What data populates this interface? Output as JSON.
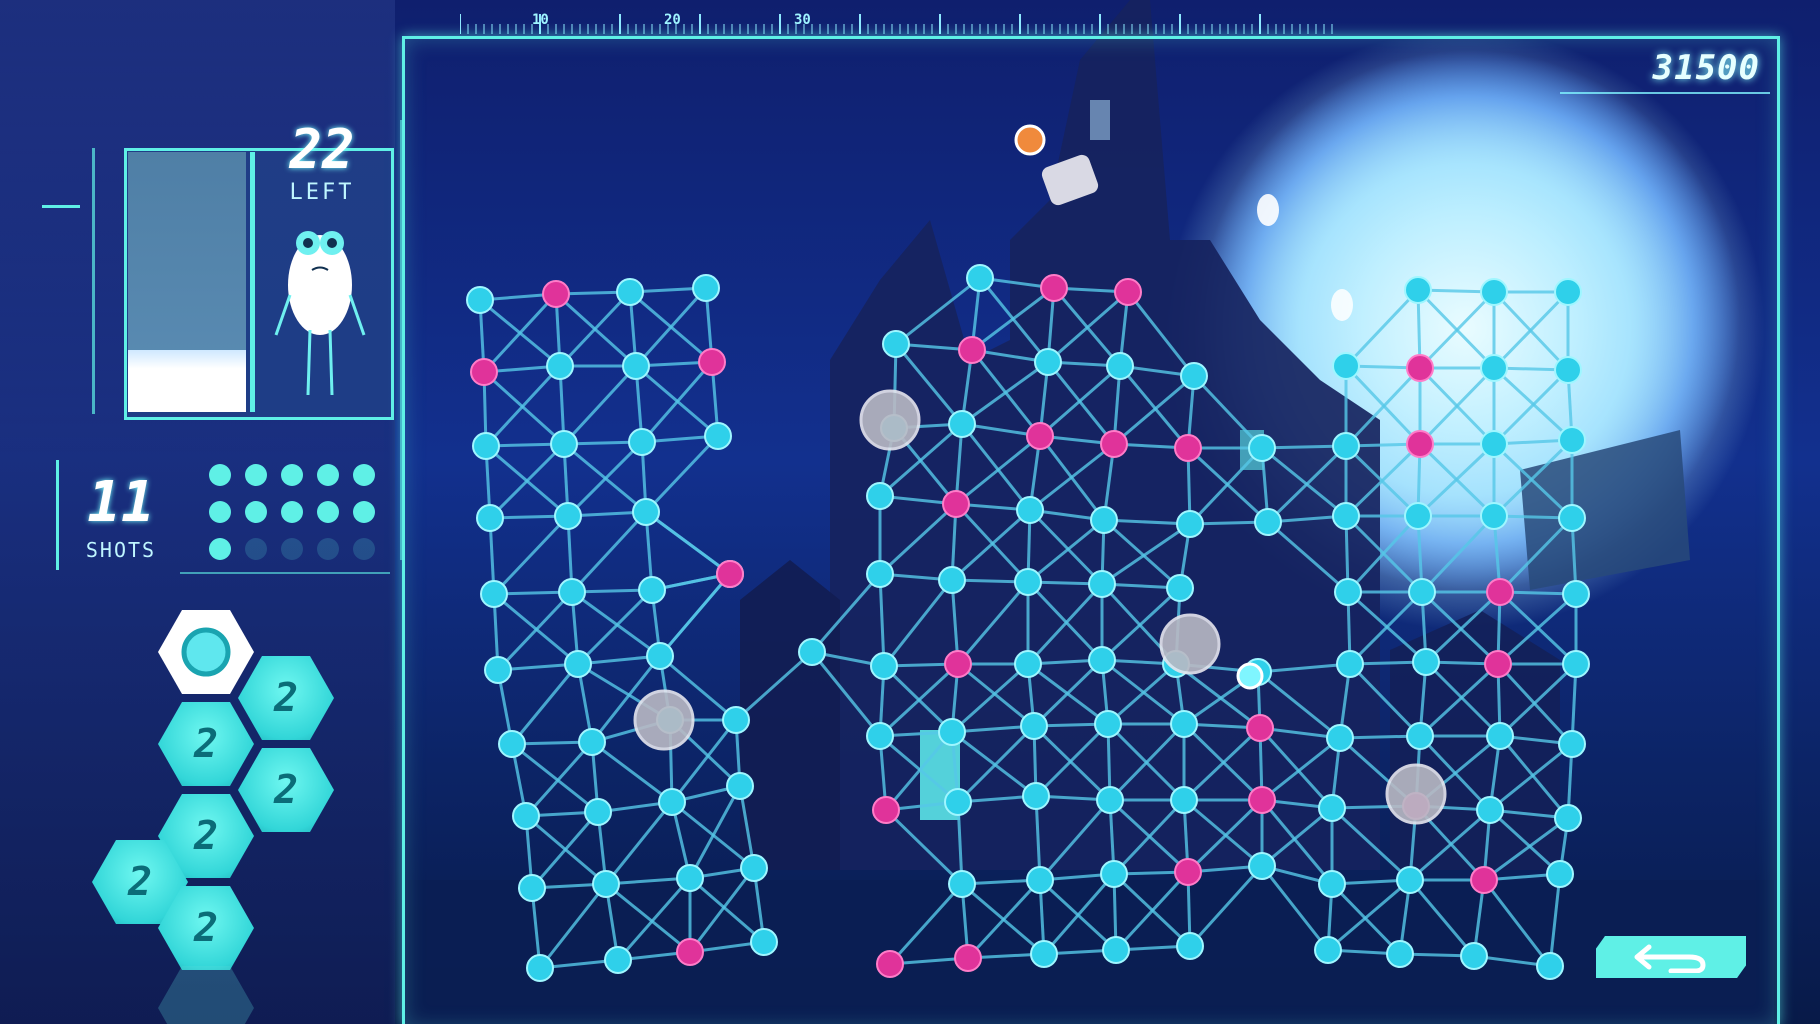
{
  "hud": {
    "score": "31500",
    "ruler_labels": [
      "10",
      "20",
      "30"
    ],
    "ghosts_left_count": "22",
    "ghosts_left_label": "LEFT",
    "ghost_meter_fraction": 0.24,
    "shots_count": "11",
    "shots_label": "SHOTS",
    "shot_pips": {
      "available": 11,
      "total": 15
    }
  },
  "powerups": [
    {
      "name": "selected-shot",
      "label": "",
      "state": "selected"
    },
    {
      "name": "powerup-switch",
      "label": "2",
      "state": "available"
    },
    {
      "name": "powerup-battery",
      "label": "2",
      "state": "available"
    },
    {
      "name": "powerup-sphere",
      "label": "2",
      "state": "available"
    },
    {
      "name": "powerup-magnet",
      "label": "2",
      "state": "available"
    },
    {
      "name": "powerup-bomb",
      "label": "2",
      "state": "available"
    },
    {
      "name": "powerup-half-circle",
      "label": "2",
      "state": "available"
    },
    {
      "name": "powerup-empty",
      "label": "",
      "state": "locked"
    }
  ],
  "colors": {
    "accent": "#5ff0e6",
    "node_cyan": "#2fd0ea",
    "node_magenta": "#e0339a",
    "link": "#56c8e8",
    "obstacle_grey": "#b9b9c4"
  },
  "buttons": {
    "back_icon": "back-arrow-icon"
  }
}
